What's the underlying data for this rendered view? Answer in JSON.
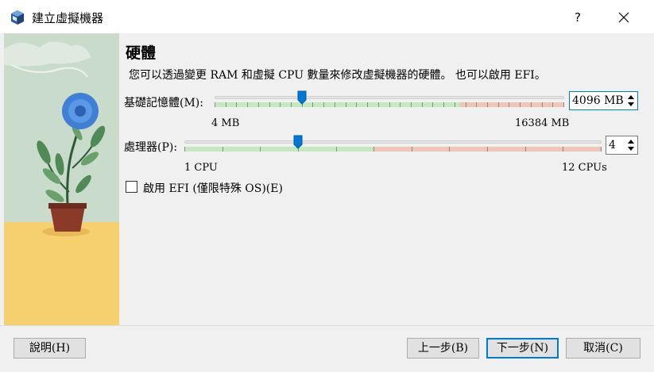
{
  "window": {
    "title": "建立虛擬機器",
    "help_label": "?",
    "icon": "virtualbox-cube-icon"
  },
  "page": {
    "title": "硬體",
    "description": "您可以透過變更 RAM 和虛擬 CPU 數量來修改虛擬機器的硬體。 也可以啟用 EFI。"
  },
  "memory": {
    "label": "基礎記憶體(M):",
    "min_label": "4 MB",
    "max_label": "16384 MB",
    "value_text": "4096 MB",
    "value": 4096,
    "min": 4,
    "max": 16384,
    "recommended_max": 11500
  },
  "processors": {
    "label": "處理器(P):",
    "min_label": "1 CPU",
    "max_label": "12 CPUs",
    "value_text": "4",
    "value": 4,
    "min": 1,
    "max": 12,
    "recommended_max": 6
  },
  "efi": {
    "label": "啟用 EFI (僅限特殊 OS)(E)",
    "checked": false
  },
  "buttons": {
    "help": "說明(H)",
    "back": "上一步(B)",
    "next": "下一步(N)",
    "cancel": "取消(C)"
  },
  "colors": {
    "accent": "#0078d7",
    "safe_zone": "#c4e9bf",
    "warn_zone": "#f1c4b8",
    "illustration_sky": "#c9dccb",
    "illustration_floor": "#f6cf6f",
    "flower": "#3f7fd6"
  }
}
